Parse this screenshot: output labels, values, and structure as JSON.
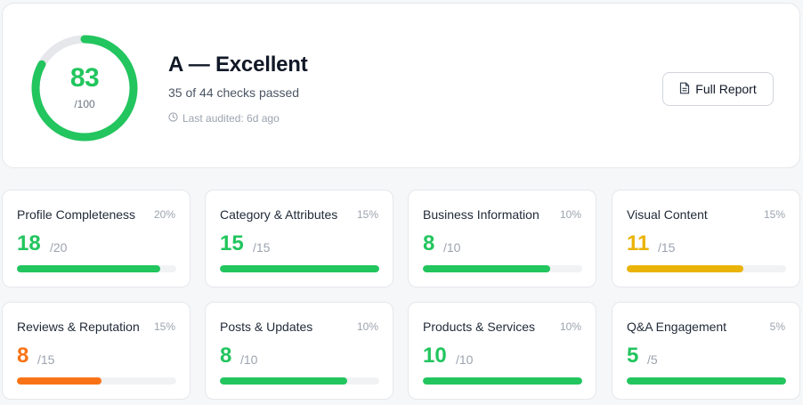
{
  "summary": {
    "score": "83",
    "score_max": "/100",
    "score_fraction": 0.83,
    "score_color": "#22c55e",
    "grade": "A — Excellent",
    "checks_text": "35 of 44 checks passed",
    "audited_text": "Last audited: 6d ago",
    "audited_icon": "clock-icon",
    "report_button": "Full Report",
    "report_icon": "document-icon"
  },
  "colors": {
    "green": "#22c55e",
    "amber": "#eab308",
    "orange": "#f97316",
    "track": "#f1f2f4"
  },
  "categories": [
    {
      "name": "Profile Completeness",
      "weight": "20%",
      "score": "18",
      "max": "/20",
      "fraction": 0.9,
      "color": "#22c55e"
    },
    {
      "name": "Category & Attributes",
      "weight": "15%",
      "score": "15",
      "max": "/15",
      "fraction": 1.0,
      "color": "#22c55e"
    },
    {
      "name": "Business Information",
      "weight": "10%",
      "score": "8",
      "max": "/10",
      "fraction": 0.8,
      "color": "#22c55e"
    },
    {
      "name": "Visual Content",
      "weight": "15%",
      "score": "11",
      "max": "/15",
      "fraction": 0.733,
      "color": "#eab308"
    },
    {
      "name": "Reviews & Reputation",
      "weight": "15%",
      "score": "8",
      "max": "/15",
      "fraction": 0.533,
      "color": "#f97316"
    },
    {
      "name": "Posts & Updates",
      "weight": "10%",
      "score": "8",
      "max": "/10",
      "fraction": 0.8,
      "color": "#22c55e"
    },
    {
      "name": "Products & Services",
      "weight": "10%",
      "score": "10",
      "max": "/10",
      "fraction": 1.0,
      "color": "#22c55e"
    },
    {
      "name": "Q&A Engagement",
      "weight": "5%",
      "score": "5",
      "max": "/5",
      "fraction": 1.0,
      "color": "#22c55e"
    }
  ]
}
